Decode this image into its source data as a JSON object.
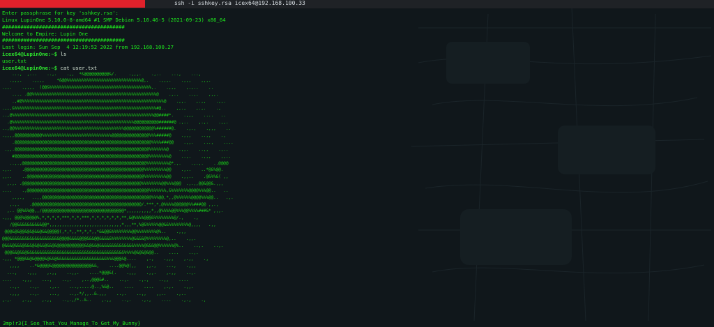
{
  "window": {
    "title": "ssh -i sshkey.rsa icex64@192.168.100.33"
  },
  "colors": {
    "terminal_green": "#1eea1e",
    "title_tab_red": "#e0212b",
    "background": "#0f1518"
  },
  "terminal": {
    "lines": [
      "Enter passphrase for key 'sshkey.rsa':",
      "Linux LupinOne 5.10.0-8-amd64 #1 SMP Debian 5.10.46-5 (2021-09-23) x86_64",
      "########################################",
      "Welcome to Empire: Lupin One",
      "########################################",
      "Last login: Sun Sep  4 12:19:52 2022 from 192.168.100.27"
    ],
    "prompt": "icex64@LupinOne:~$",
    "cmd_ls": " ls",
    "ls_output": "user.txt",
    "cmd_cat": " cat user.txt",
    "art": [
      "    ...,  ,...    ..,.    .,,  *&@@@@@@@@@@&/.     .,,,.    .,..    ...,    ...,",
      "   .,,,.    .,,,,     *&@@%%%%%%%%%%%%%%%%%%%%%%%%%%%%%%@,.    .,,,.    .,,,    ,,,.",
      ".,,.    .,,,,  (@@&%%%%%%%%%%%%%%%%%%%%%%%%%%%%%%%%%%%%%%%%%,.    .,,,    ,.,..    ..",
      "    .... .@@%%%%%%%%%%%%%%%%%%%%%%%%%%%%%%%%%%%%%%%%%%%%%%%%%%@    .,..    ..,.    ,,,.",
      "    .,#@%%%%%%%%%%%%%%%%%%%%%%%%%%%%%%%%%%%%%%%%%%%%%%%%%%%%%%%%%@    .,,.    ,.,,    .,,.",
      ".,,,&%%%%%%%%%%%%%%%%%%%%%%%%%%%%%%%%%%%%%%%%%%%%%%%%%%%%%%%%%#@..    ,,.,    ,.,.    .,",
      "..,@%%%%%%%%%%%%%%%%%%%%%%%%%%%%%%%%%%%%%%%%%%%%%%%%%%%%%%%%%@@####*.    .,,,    ....   ..",
      "  .@%%%%%%%%%%%%%%%%%%%%%%%%%%%%%%%%%%%%%%%%%%%%%%%%%@@@@@@@@@@######@ .,..    ,.,.    .,,.",
      "..,@@%%%%%%%%%%%%%%%%%%%%%%%%%%%%%%%%%%%%%%%%%%%%@@@@@@@@@@@@%######@.    .,.,    .,,,    ..",
      ".,,,,@@@@@@@@@@@%%%%%%%%%%%%%%%%%%%%%%%%%%%%@@@@@@@@@@@@@@@%%%#####@    .,,,    ..,,    .,",
      "    .@@@@@@@@@@@@@@@@@@@@@@@@@@@@@@@@@@@@@@@@@@@@@@@@@@@@@@@%%%%###@@    .,,.    ...,    ....",
      " .,,.@@@@@@@@@@@@@@@@@@@@@@@@@@@@@@@@@@@@@@@@@@@@@@@@@@@@@@%%%%%%%@    .,,.    ..,,    .,..",
      "    #@@@@@@@@@@@@@@@@@@@@@@@@@@@@@@@@@@@@@@@@@@@@@@@@@@@@@@%%%%%%%%@    ..,.    .,,,    ,,..",
      "   ..,.,@@@@@@@@@@@@@@@@@@@@@@@@@@@@@@@@@@@@@@@@@@@@@@@@@@%%%%%%%%%@*.,.    .,.,.    ..@@@@",
      ".,..    .@@@@@@@@@@@@@@@@@@@@@@@@@@@@@@@@@@@@@@@@@@@@@@@@%%%%%%%%%@@    .,..    ..*@&%@@.",
      ",,..    ..@@@@@@@@@@@@@@@@@@@@@@@@@@@@@@@@@@@@@@@@@@@@@@@%%%%%%%%%@@    .,,..    .@&%%&( ,,",
      "  ,.,. .@@@@@@@@@@@@@@@@@@@@@@@@@@@@@@@@@@@@@@@@@@@@@@@@%%%%%%%%@@%%%@@@  .,.,,@@&@@&.,,,",
      "....    .,@@@@@@@@@@@@@@@@@@@@@@@@@@@@@@@@@@@@@@@@@@@@@@@@@%%%%%%%,&%%%%%%%@@@@%%%@@..   ..",
      "    ,.,.,   ..,,@@@@@@@@@@@@@@@@@@@@@@@@@@@@@@@@@@@@@@@@@@@@%%%@@,*,,@%%%%%%@@@@%%%@@..   .,.",
      "   ,.,.    .@@@@@@@@@@@@@@@@@@@@@@@@@@@@@@@@@@@@@@@@@@@@/.***,*,@%%%%@@@@@@%%###@@ ,,.,",
      "  ,.. @@%&%@@,,/@@@@@@@@@@@@@@@@@@@@@@@@@@@@@@@@@*,,,,,,,,,,*,,@%%%%@@%%%@@%%%%###&* ,,,.",
      ".,,, @@@%@@@@@%,*,*,*,*,***,*,*,***,*,*,*,*,*,*,**,&@%%%%@@@&%%%%%%%%@/.,    .,",
      "   /@@&&&&&&&&&&@@*,,,,,,,,,,,,,,,,,,,,,,,,,,,,,*,,,**,%@&%%%%%@@&&%%%%%%%%@,,,,   .,,",
      " @@@&@&@@&@&@&&@&&@@@@@(,*,*,,**,*,*,,*&&@@&%%%%%%%%@@%%%%%%%%@%..    .,,,",
      "@@@&&&&&&&&&&&&&&&&&&&&@@@@&&&&@@@&&&@@&&&&&%%%%%%%%@&&&&@%%%%%%%%@,..    .,,.",
      "@&&&@&&&@&&&@&@&&@&&@&@@@@@@@@@@@&&@&&@&&&&&&&&&&&&&&%%%%@&&&@@%%%%%%@%..    ..,.    ..,.",
      " @@@&&@&&@&&&&&&&&&&&&&&&&&&&&&&&&&&&&&&&&&&&&&&&%%%%@&@&@&@@..    ....    ..,.",
      ".,,, *@@@&&@&@@@@&@&&@&&&&&&&&&&&&&&&&&&&&%%&@@@&@....    ,.,    .,,,    ,.,,    .,",
      "   ,,,,    ..*&@@@@&@@@@@@@@@@@@@@@@&&,    ....@@%@(,,    ,,.,    ...,    .,,,",
      "  ...,    .,,,    ,.,,    ..,,.    ....*@@@&(.    .,,,    .,,.    ,.,,    ..,.",
      "....    .,,,    ...,    ..,.    ,..,@@@&#..    ..,.    .,.,    ..,,    ....",
      "   ..,.    ..,.    .,..    ...,.....@..,%&@..    ....    ....    ,.,.    .,,.",
      "   .,,,    ..,.    ...,    ..,.*/,,..&.,,,    ..,.    ..,,    ,,..    .,..",
      ",.,.    ,.,,    ,.,,    ..,.,/*..&..    ,.,,    ..,.    .,.,    ....    .,.,    .,"
    ],
    "flag": "3mp!r3{I_See_That_You_Manage_To_Get_My_Bunny}"
  }
}
